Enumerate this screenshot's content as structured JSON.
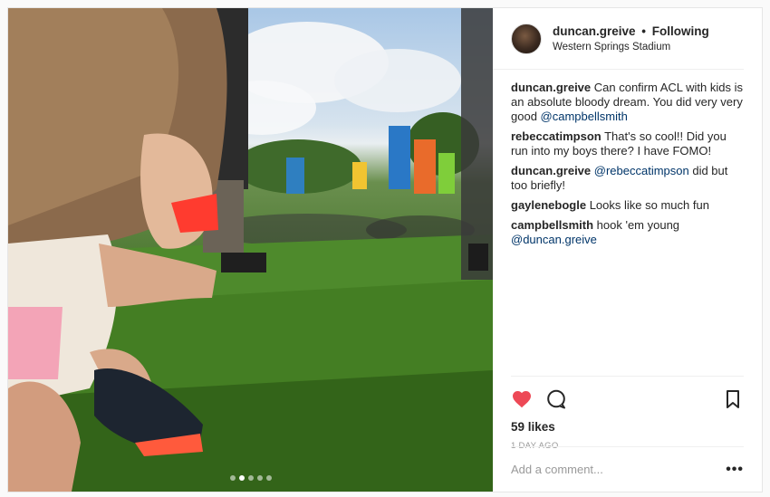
{
  "post": {
    "username": "duncan.greive",
    "separator": "•",
    "follow_status": "Following",
    "location": "Western Springs Stadium",
    "likes_text": "59 likes",
    "time_ago": "1 DAY AGO",
    "add_comment_placeholder": "Add a comment...",
    "more_label": "•••",
    "carousel_count": 5,
    "carousel_active_index": 1,
    "liked": true
  },
  "comments": [
    {
      "user": "duncan.greive",
      "text": "Can confirm ACL with kids is an absolute bloody dream. You did very very good ",
      "mention": "@campbellsmith"
    },
    {
      "user": "rebeccatimpson",
      "text": "That's so cool!! Did you run into my boys there? I have FOMO!",
      "mention": ""
    },
    {
      "user": "duncan.greive",
      "text": "",
      "mention": "@rebeccatimpson",
      "after": " did but too briefly!"
    },
    {
      "user": "gaylenebogle",
      "text": "Looks like so much fun",
      "mention": ""
    },
    {
      "user": "campbellsmith",
      "text": "hook 'em young ",
      "mention": "@duncan.greive"
    }
  ],
  "icons": {
    "heart": "heart-filled-icon",
    "comment": "comment-bubble-icon",
    "save": "bookmark-icon"
  },
  "colors": {
    "heart": "#ed4956",
    "mention": "#003569",
    "secondary_text": "#999999"
  }
}
